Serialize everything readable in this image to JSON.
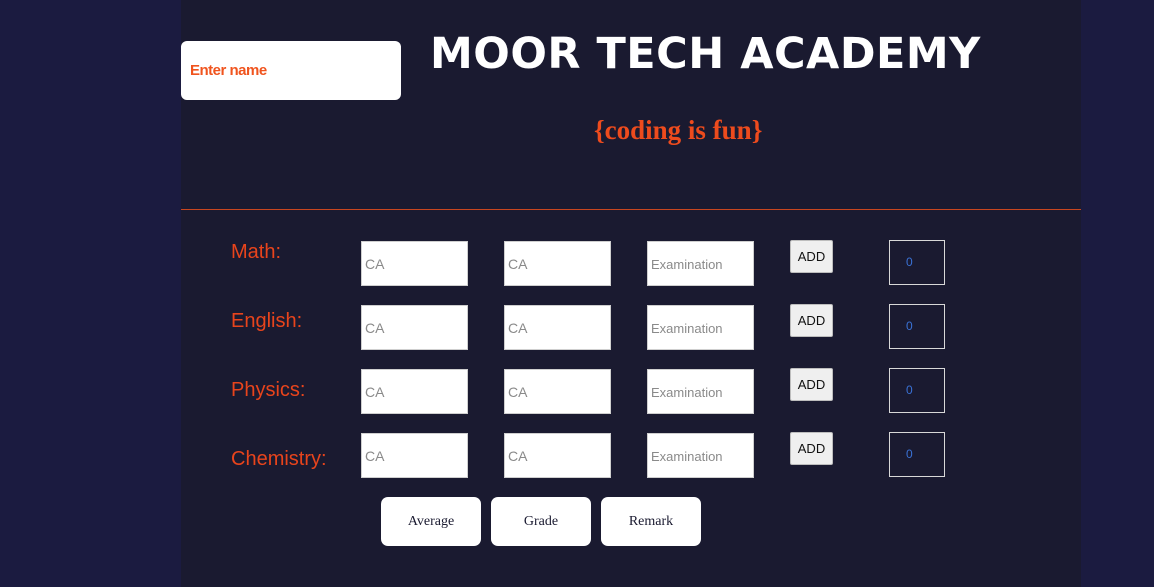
{
  "header": {
    "name_placeholder": "Enter name",
    "title": "MOOR TECH ACADEMY",
    "tagline": "{coding is fun}"
  },
  "subjects": [
    {
      "label": "Math:",
      "ca1_placeholder": "CA",
      "ca2_placeholder": "CA",
      "exam_placeholder": "Examination",
      "add_label": "ADD",
      "total": "0"
    },
    {
      "label": "English:",
      "ca1_placeholder": "CA",
      "ca2_placeholder": "CA",
      "exam_placeholder": "Examination",
      "add_label": "ADD",
      "total": "0"
    },
    {
      "label": "Physics:",
      "ca1_placeholder": "CA",
      "ca2_placeholder": "CA",
      "exam_placeholder": "Examination",
      "add_label": "ADD",
      "total": "0"
    },
    {
      "label": "Chemistry:",
      "ca1_placeholder": "CA",
      "ca2_placeholder": "CA",
      "exam_placeholder": "Examination",
      "add_label": "ADD",
      "total": "0"
    }
  ],
  "actions": {
    "average_label": "Average",
    "grade_label": "Grade",
    "remark_label": "Remark"
  },
  "colors": {
    "background": "#1b1b40",
    "panel": "#1a1a30",
    "accent": "#ee4b1d",
    "total_text": "#3a72d6"
  }
}
